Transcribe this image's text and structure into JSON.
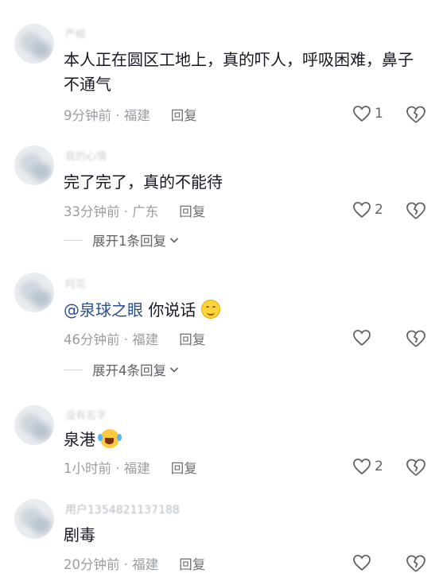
{
  "comments": [
    {
      "username": "严峻",
      "text": "本人正在圆区工地上，真的吓人，呼吸困难，鼻子不通气",
      "time": "9分钟前",
      "location": "福建",
      "reply_label": "回复",
      "likes": "1"
    },
    {
      "username": "我的心情",
      "text": "完了完了，真的不能待",
      "time": "33分钟前",
      "location": "广东",
      "reply_label": "回复",
      "likes": "2",
      "expand_label": "展开1条回复"
    },
    {
      "username": "阿花",
      "mention": "@泉球之眼",
      "text": " 你说话",
      "time": "46分钟前",
      "location": "福建",
      "reply_label": "回复",
      "likes": "",
      "expand_label": "展开4条回复"
    },
    {
      "username": "没有名字",
      "text": "泉港",
      "time": "1小时前",
      "location": "福建",
      "reply_label": "回复",
      "likes": "2"
    },
    {
      "username": "用户1354821137188",
      "text": "剧毒",
      "time": "20分钟前",
      "location": "福建",
      "reply_label": "回复",
      "likes": ""
    }
  ],
  "icons": {
    "like": "heart-outline-icon",
    "dislike": "broken-heart-icon",
    "expand": "chevron-down-icon",
    "emoji_smile": "smile-emoji",
    "emoji_cry": "laugh-cry-emoji"
  },
  "colors": {
    "text": "#161823",
    "meta": "#9a9da2",
    "mention": "#2a4f8c"
  }
}
